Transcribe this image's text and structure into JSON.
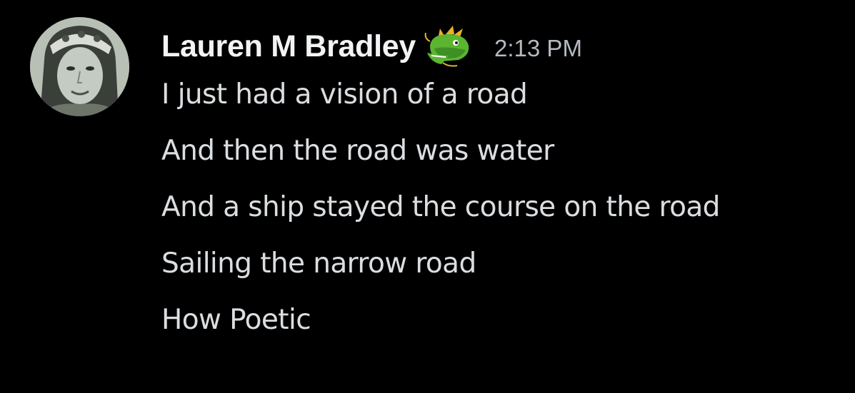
{
  "message": {
    "author": "Lauren M Bradley",
    "role_icon": "dragon-icon",
    "timestamp": "2:13 PM",
    "lines": [
      "I just had a vision of a road",
      "And then the road was water",
      "And a ship stayed the course on the road",
      "Sailing the narrow road",
      "How Poetic"
    ]
  },
  "colors": {
    "background": "#000000",
    "username": "#f2f3f5",
    "timestamp": "#b5bac1",
    "message_text": "#dbdee1",
    "dragon_green": "#5cb531"
  }
}
